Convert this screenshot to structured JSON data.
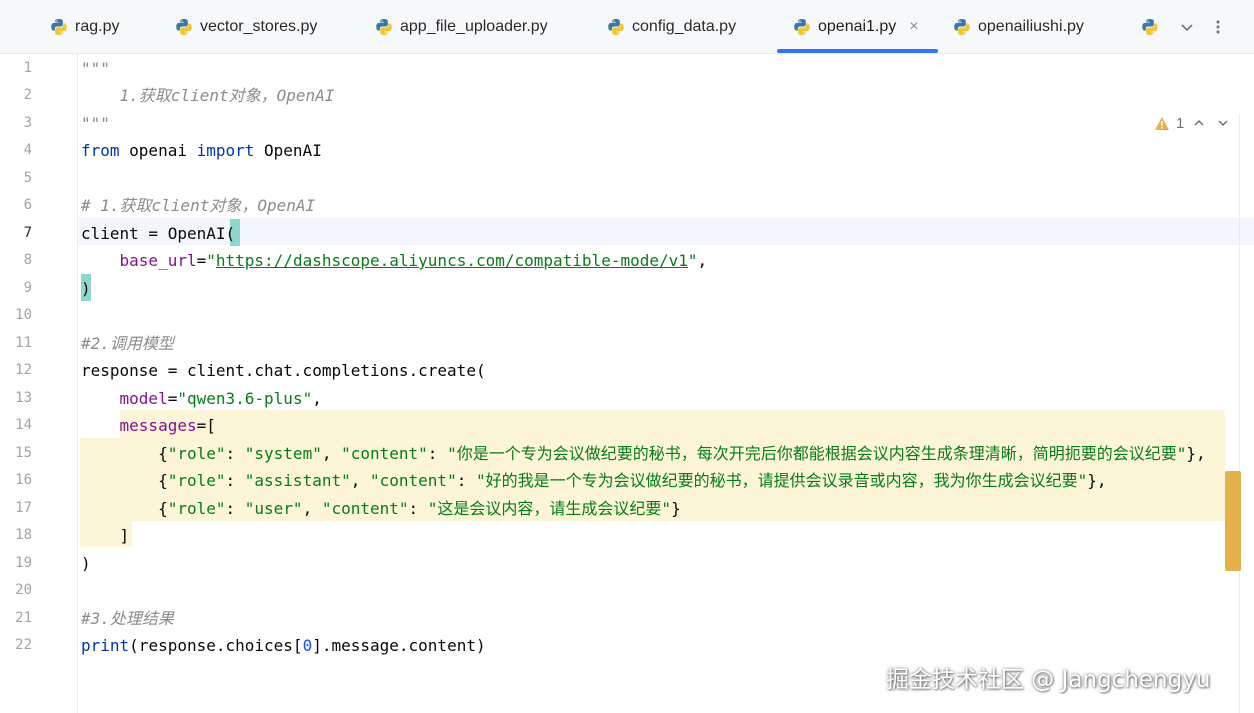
{
  "tabs": [
    {
      "label": "rag.py",
      "active": false
    },
    {
      "label": "vector_stores.py",
      "active": false
    },
    {
      "label": "app_file_uploader.py",
      "active": false
    },
    {
      "label": "config_data.py",
      "active": false
    },
    {
      "label": "openai1.py",
      "active": true
    },
    {
      "label": "openailiushi.py",
      "active": false
    },
    {
      "label": "",
      "active": false
    }
  ],
  "tabbar_icons": {
    "overflow": "chevron-down-icon",
    "menu": "more-vertical-icon",
    "close": "×"
  },
  "inspection": {
    "icon": "warning-icon",
    "count": "1"
  },
  "current_line": "7",
  "line_numbers": [
    "1",
    "2",
    "3",
    "4",
    "5",
    "6",
    "7",
    "8",
    "9",
    "10",
    "11",
    "12",
    "13",
    "14",
    "15",
    "16",
    "17",
    "18",
    "19",
    "20",
    "21",
    "22"
  ],
  "code": {
    "l1": "\"\"\"",
    "l2_indent": "    ",
    "l2": "1.获取client对象，OpenAI",
    "l3": "\"\"\"",
    "l4_from": "from",
    "l4_mod": " openai ",
    "l4_import": "import",
    "l4_name": " OpenAI",
    "l6": "# 1.获取client对象，OpenAI",
    "l7": "client = OpenAI(",
    "l8_param": "base_url",
    "l8_eq": "=",
    "l8_q1": "\"",
    "l8_url": "https://dashscope.aliyuncs.com/compatible-mode/v1",
    "l8_q2": "\"",
    "l8_comma": ",",
    "l9": ")",
    "l11": "#2.调用模型",
    "l12": "response = client.chat.completions.create(",
    "l13_param": "model",
    "l13_eq": "=",
    "l13_str": "\"qwen3.6-plus\"",
    "l13_comma": ",",
    "l14_param": "messages",
    "l14_rest": "=[",
    "l15": {
      "k1": "\"role\"",
      "v1": "\"system\"",
      "k2": "\"content\"",
      "v2": "\"你是一个专为会议做纪要的秘书，每次开完后你都能根据会议内容生成条理清晰，简明扼要的会议纪要\"",
      "end": "},"
    },
    "l16": {
      "k1": "\"role\"",
      "v1": "\"assistant\"",
      "k2": "\"content\"",
      "v2": "\"好的我是一个专为会议做纪要的秘书，请提供会议录音或内容，我为你生成会议纪要\"",
      "end": "},"
    },
    "l17": {
      "k1": "\"role\"",
      "v1": "\"user\"",
      "k2": "\"content\"",
      "v2": "\"这是会议内容，请生成会议纪要\"",
      "end": "}"
    },
    "l18": "]",
    "l19": ")",
    "l21": "#3.处理结果",
    "l22_fn": "print",
    "l22_a": "(response.choices[",
    "l22_num": "0",
    "l22_b": "].message.content)"
  },
  "colors": {
    "accent": "#3574f0",
    "keyword": "#0033b3",
    "string": "#067d17",
    "comment": "#8c8c8c",
    "parameter": "#871094",
    "number": "#1750eb",
    "highlight": "#fcf5d8",
    "brace_match": "#8fd6ce",
    "warning": "#e4b04a"
  },
  "watermark": "掘金技术社区 @ Jangchengyu"
}
